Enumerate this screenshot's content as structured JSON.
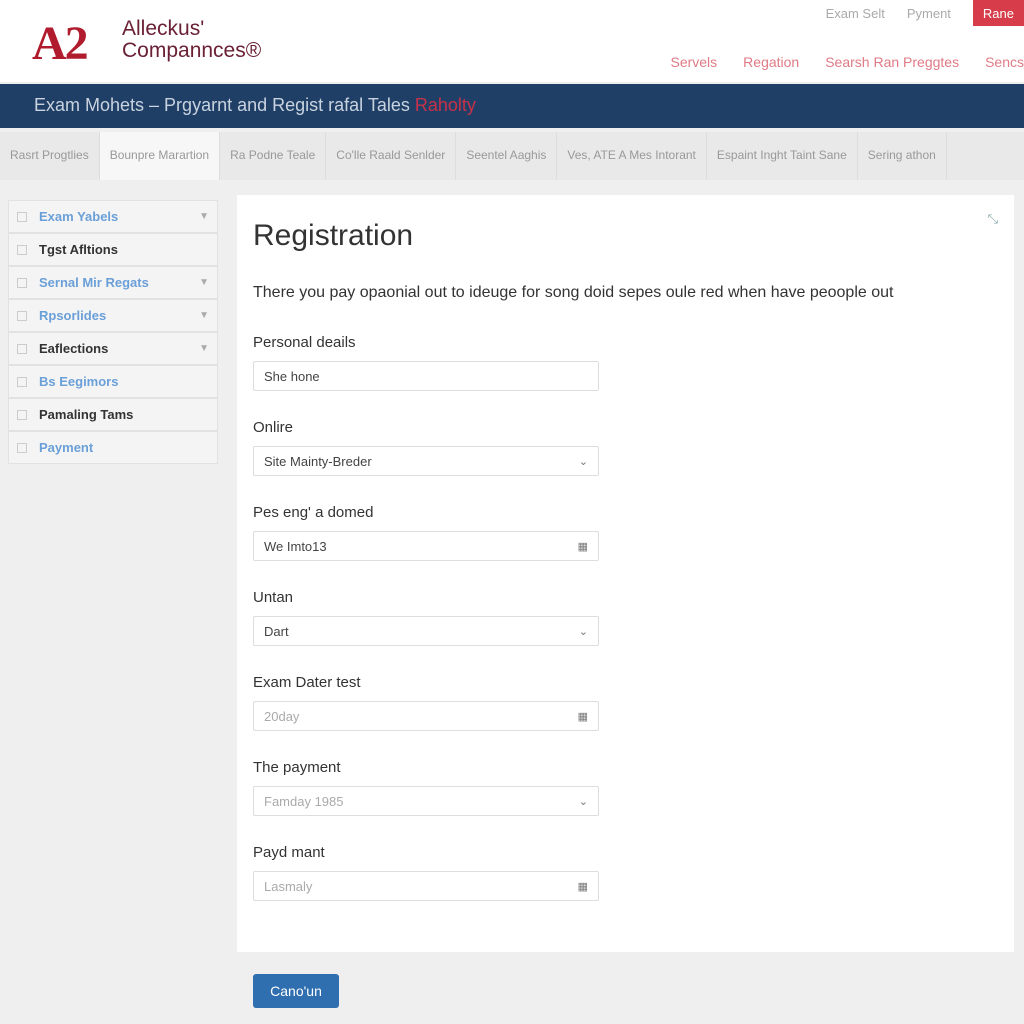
{
  "header": {
    "logo_mark": "A2",
    "logo_line1": "Alleckus'",
    "logo_line2": "Compannces®",
    "top_links": [
      "Exam Selt",
      "Pyment"
    ],
    "top_cta": "Rane",
    "nav": [
      "Servels",
      "Regation",
      "Searsh Ran Preggtes",
      "Sencs"
    ]
  },
  "banner": {
    "title": "Exam Mohets – Prgyarnt and Regist rafal Tales",
    "highlight": "Raholty"
  },
  "tabs": [
    "Rasrt Progtlies",
    "Bounpre Marartion",
    "Ra Podne Teale",
    "Co'lle Raald Senlder",
    "Seentel Aaghis",
    "Ves, ATE A Mes Intorant",
    "Espaint Inght Taint Sane",
    "Sering athon"
  ],
  "sidebar": {
    "items": [
      {
        "label": "Exam Yabels",
        "blue": true,
        "chev": true
      },
      {
        "label": "Tgst Afltions",
        "blue": false,
        "chev": false
      },
      {
        "label": "Sernal Mir Regats",
        "blue": true,
        "chev": true
      },
      {
        "label": "Rpsorlides",
        "blue": true,
        "chev": true
      },
      {
        "label": "Eaflections",
        "blue": false,
        "chev": true
      },
      {
        "label": "Bs Eegimors",
        "blue": true,
        "chev": false
      },
      {
        "label": "Pamaling Tams",
        "blue": false,
        "chev": false
      },
      {
        "label": "Payment",
        "blue": true,
        "chev": false
      }
    ]
  },
  "form": {
    "title": "Registration",
    "intro": "There you pay opaonial out to ideuge for song doid sepes oule red when have peoople out",
    "fields": [
      {
        "label": "Personal deails",
        "value": "She hone",
        "icon": ""
      },
      {
        "label": "Onlire",
        "value": "Site Mainty-Breder",
        "icon": "chevron-down"
      },
      {
        "label": "Pes eng' a domed",
        "value": "We Imto13",
        "icon": "calendar"
      },
      {
        "label": "Untan",
        "value": "Dart",
        "icon": "chevron-down"
      },
      {
        "label": "Exam Dater test",
        "value": "20day",
        "icon": "calendar"
      },
      {
        "label": "The payment",
        "value": "Famday 1985",
        "icon": "chevron-down"
      },
      {
        "label": "Payd mant",
        "value": "Lasmaly",
        "icon": "calendar"
      }
    ]
  },
  "button": "Cano'un",
  "colors": {
    "navy": "#1f3f66",
    "brand_red": "#b01c2e",
    "button": "#2f6fb0"
  }
}
